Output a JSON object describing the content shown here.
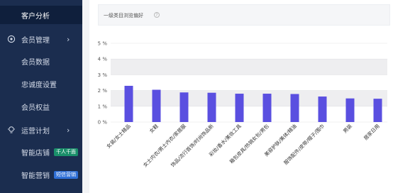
{
  "sidebar": {
    "top_item": {
      "label": "客户分析"
    },
    "member_mgmt": {
      "label": "会员管理",
      "icon": "member-gear-icon",
      "chevron": "›"
    },
    "member_items": [
      "会员数据",
      "忠诚度设置",
      "会员权益"
    ],
    "ops_plan": {
      "label": "运营计划",
      "icon": "bulb-icon",
      "chevron": "›"
    },
    "ops_items": [
      {
        "label": "智能店铺",
        "badge": "千人千面",
        "badge_color": "#1a8f6a"
      },
      {
        "label": "智能营销",
        "badge": "短信营销",
        "badge_color": "#2f6fd6"
      }
    ]
  },
  "panel": {
    "title": "一级类目浏览偏好",
    "help_icon": "question-circle-icon"
  },
  "chart_data": {
    "type": "bar",
    "title": "一级类目浏览偏好",
    "categories": [
      "女装/女士精品",
      "女鞋",
      "女士内衣/男士内衣/家居服",
      "饰品/流行首饰/时尚饰品新",
      "彩妆/香水/美妆工具",
      "箱包皮具/热销女包/男包",
      "美容护肤/美体/精油",
      "服饰配件/皮带/帽子/围巾",
      "男装",
      "居家日用"
    ],
    "values": [
      2.3,
      2.05,
      1.88,
      1.86,
      1.8,
      1.8,
      1.78,
      1.62,
      1.5,
      1.48
    ],
    "ylim": [
      0,
      5
    ],
    "yticks": [
      "0 %",
      "1 %",
      "2 %",
      "3 %",
      "4 %",
      "5 %"
    ],
    "bar_color": "#5a4fe0",
    "band_color": "#eeeef0",
    "grid": true
  }
}
